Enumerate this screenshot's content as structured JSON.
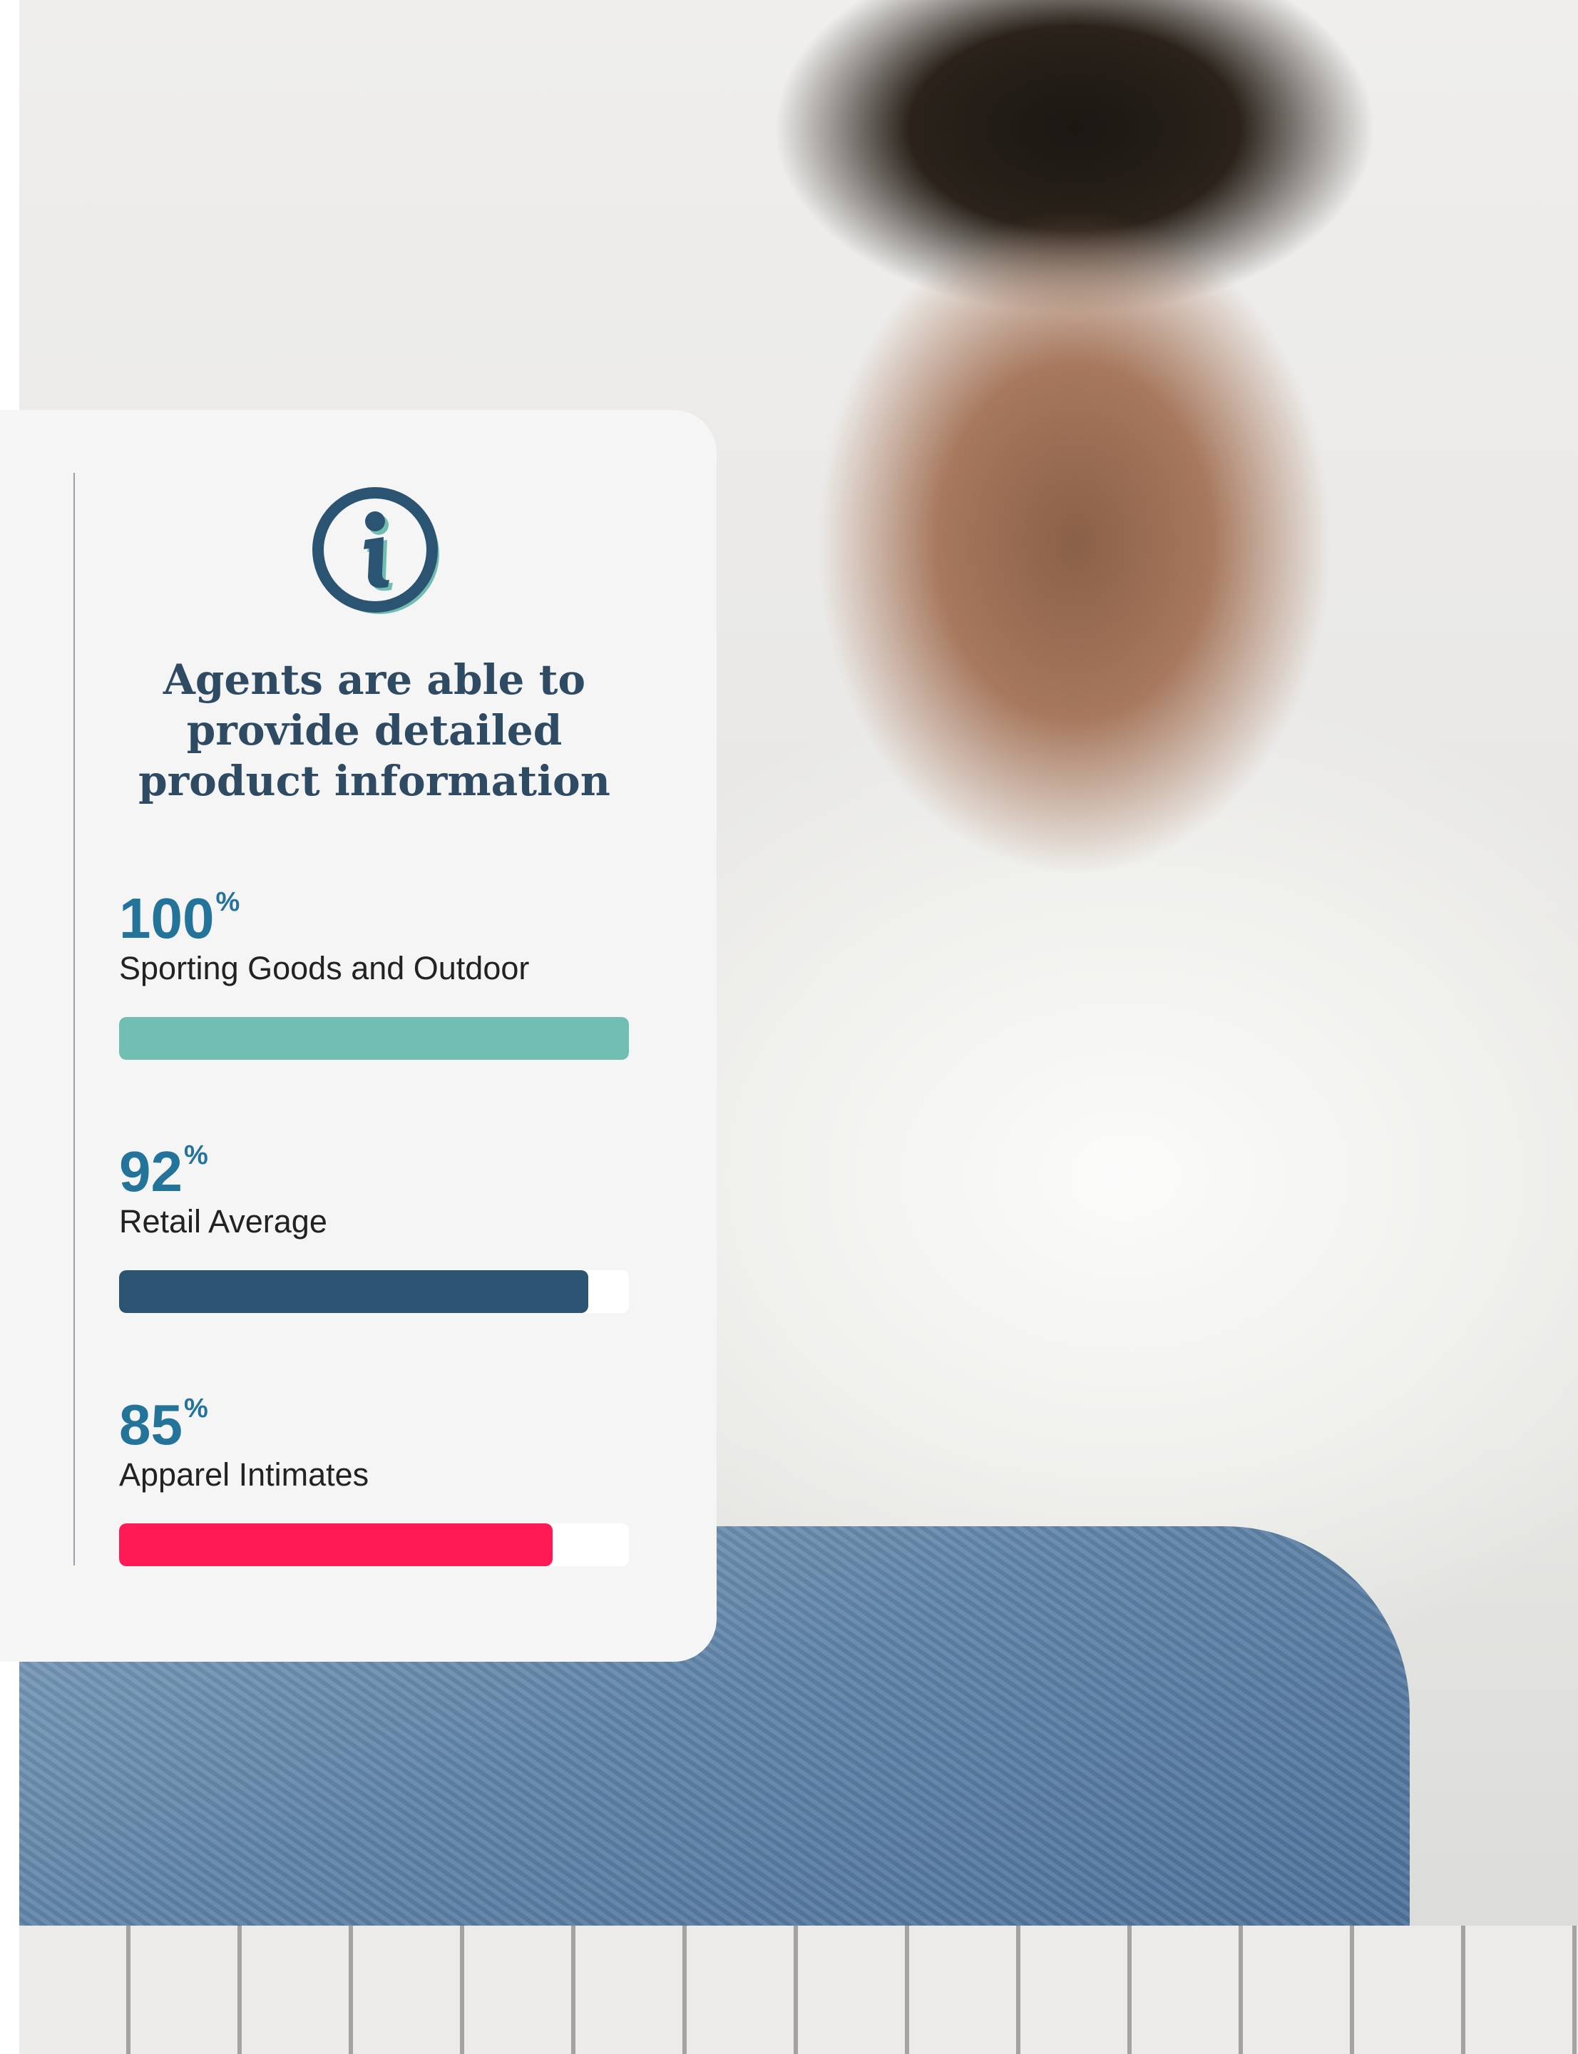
{
  "panel": {
    "icon": "info-icon",
    "headline": "Agents are able to provide detailed product information"
  },
  "stats": [
    {
      "value": "100",
      "unit": "%",
      "label": "Sporting Goods and Outdoor",
      "percent": 100,
      "color": "#72bdb2"
    },
    {
      "value": "92",
      "unit": "%",
      "label": "Retail Average",
      "percent": 92,
      "color": "#2b5372"
    },
    {
      "value": "85",
      "unit": "%",
      "label": "Apparel Intimates",
      "percent": 85,
      "color": "#ff1a56"
    }
  ],
  "colors": {
    "panel_background": "#f5f5f5",
    "heading": "#2f4a63",
    "stat_value": "#23739a",
    "icon": "#2b5372",
    "icon_shadow": "#72bdb2"
  },
  "background_image": "woman-holding-jeans-on-hanger-photo"
}
